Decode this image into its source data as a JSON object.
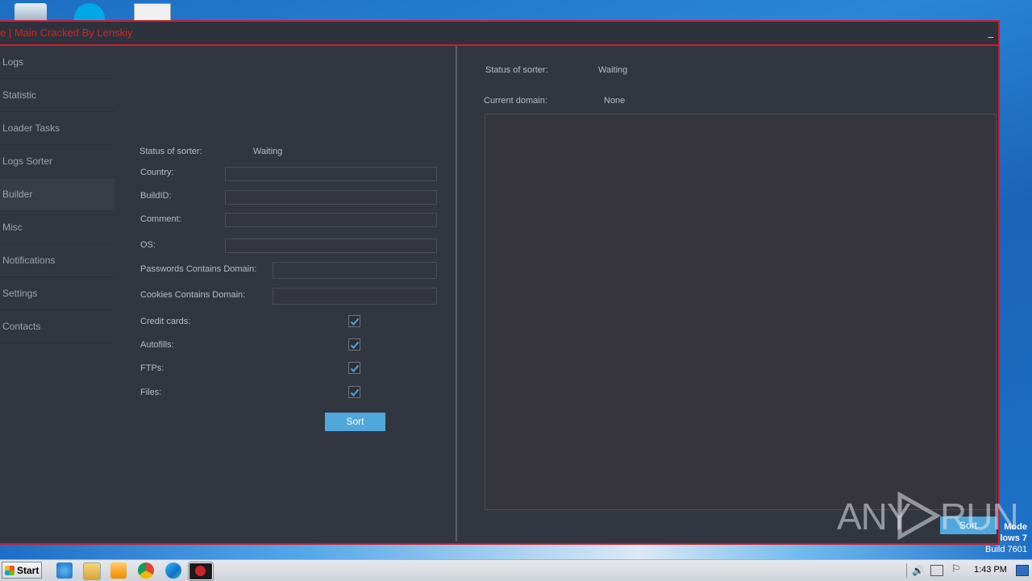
{
  "window": {
    "title": "e | Main Cracked By Lenskiy",
    "minimize_label": "_"
  },
  "sidebar": {
    "items": [
      {
        "label": "Logs"
      },
      {
        "label": "Statistic"
      },
      {
        "label": "Loader Tasks"
      },
      {
        "label": "Logs Sorter"
      },
      {
        "label": "Builder"
      },
      {
        "label": "Misc"
      },
      {
        "label": "Notifications"
      },
      {
        "label": "Settings"
      },
      {
        "label": "Contacts"
      }
    ],
    "active_index": 4
  },
  "left_form": {
    "status_label": "Status of sorter:",
    "status_value": "Waiting",
    "country_label": "Country:",
    "country_value": "",
    "buildid_label": "BuildID:",
    "buildid_value": "",
    "comment_label": "Comment:",
    "comment_value": "",
    "os_label": "OS:",
    "os_value": "",
    "passwords_label": "Passwords Contains Domain:",
    "passwords_value": "",
    "cookies_label": "Cookies Contains Domain:",
    "cookies_value": "",
    "credit_cards_label": "Credit cards:",
    "credit_cards_checked": true,
    "autofills_label": "Autofills:",
    "autofills_checked": true,
    "ftps_label": "FTPs:",
    "ftps_checked": true,
    "files_label": "Files:",
    "files_checked": true,
    "sort_button": "Sort"
  },
  "right_panel": {
    "status_label": "Status of sorter:",
    "status_value": "Waiting",
    "domain_label": "Current domain:",
    "domain_value": "None",
    "sort_button": "Sort"
  },
  "watermark": {
    "text_left": "ANY",
    "text_right": "RUN"
  },
  "desktop": {
    "mode_line1": "Mode",
    "mode_line2": "lows 7",
    "build": "Build 7601"
  },
  "taskbar": {
    "start_label": "Start",
    "clock": "1:43 PM",
    "icons": [
      "ie-icon",
      "explorer-icon",
      "media-player-icon",
      "chrome-icon",
      "edge-icon",
      "app-icon"
    ]
  },
  "colors": {
    "window_bg": "#323641",
    "border_red": "#d11a2a",
    "title_red": "#e02020",
    "button_blue": "#4fa7dc"
  }
}
